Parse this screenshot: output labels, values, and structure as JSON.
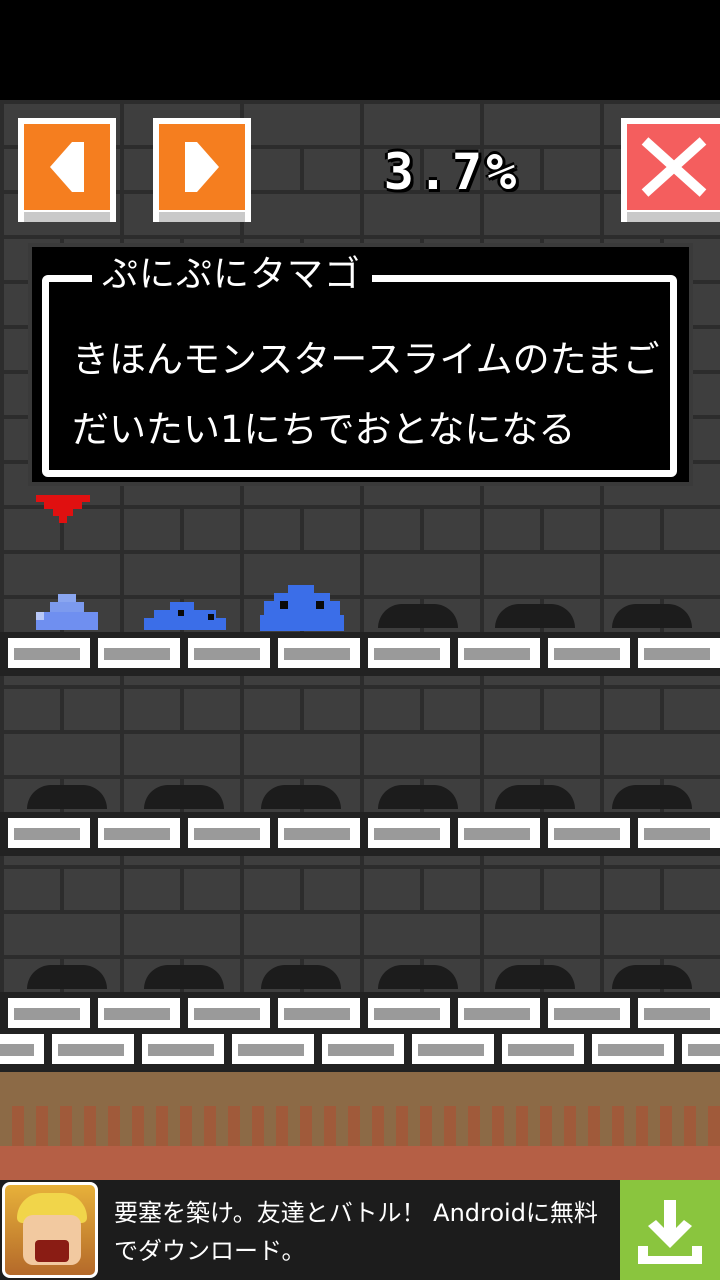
{
  "hud": {
    "prev_button": "left-arrow-icon",
    "next_button": "right-arrow-icon",
    "progress": "3.7%",
    "close_button": "close-icon"
  },
  "dialog": {
    "title": "ぷにぷにタマゴ",
    "line1": "きほんモンスタースライムのたまご",
    "line2": "だいたい1にちでおとなになる"
  },
  "colors": {
    "nav_button": "#f57e1f",
    "close_button": "#f45e5e",
    "slime": "#3b6ee8",
    "marker": "#e01010",
    "download": "#8ac53e"
  },
  "ad": {
    "text": "要塞を築け。友達とバトル！ Androidに無料でダウンロード。",
    "download_icon": "download-icon"
  }
}
